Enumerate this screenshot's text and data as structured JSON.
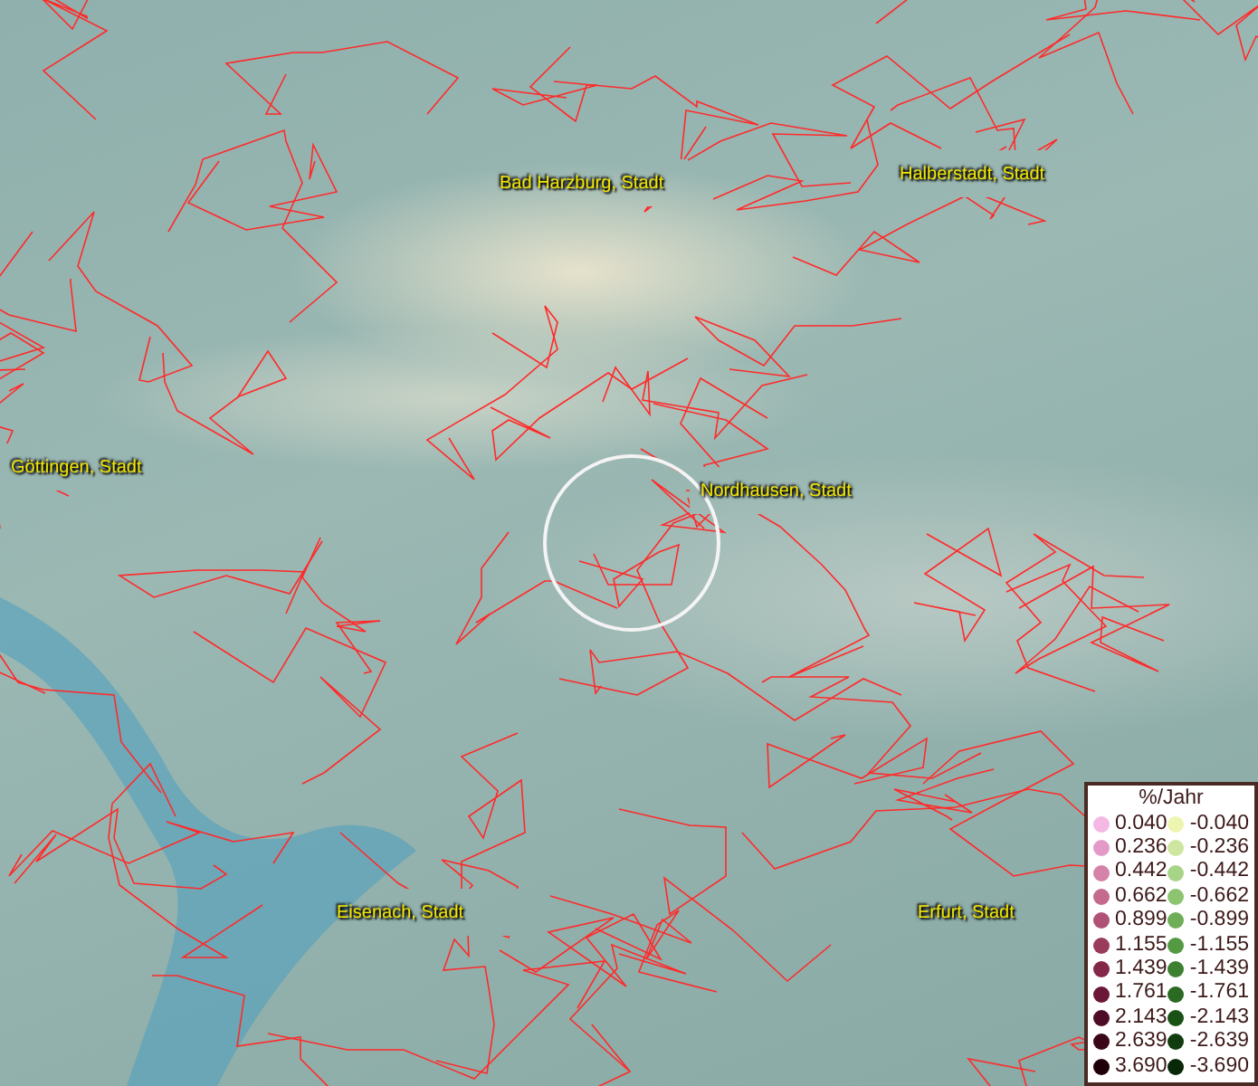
{
  "map": {
    "places": [
      {
        "name": "Bad Harzburg, Stadt"
      },
      {
        "name": "Halberstadt, Stadt"
      },
      {
        "name": "Göttingen, Stadt"
      },
      {
        "name": "Nordhausen, Stadt"
      },
      {
        "name": "Eisenach, Stadt"
      },
      {
        "name": "Erfurt, Stadt"
      }
    ]
  },
  "legend": {
    "title": "%/Jahr",
    "rows": [
      {
        "positive": {
          "value": "0.040",
          "color": "#f4b8e4"
        },
        "negative": {
          "value": "-0.040",
          "color": "#eef5b0"
        }
      },
      {
        "positive": {
          "value": "0.236",
          "color": "#e39ac8"
        },
        "negative": {
          "value": "-0.236",
          "color": "#cde6a0"
        }
      },
      {
        "positive": {
          "value": "0.442",
          "color": "#d482a8"
        },
        "negative": {
          "value": "-0.442",
          "color": "#a8d488"
        }
      },
      {
        "positive": {
          "value": "0.662",
          "color": "#c46a8c"
        },
        "negative": {
          "value": "-0.662",
          "color": "#8cc470"
        }
      },
      {
        "positive": {
          "value": "0.899",
          "color": "#b05275"
        },
        "negative": {
          "value": "-0.899",
          "color": "#6fae58"
        }
      },
      {
        "positive": {
          "value": "1.155",
          "color": "#9a3b5c"
        },
        "negative": {
          "value": "-1.155",
          "color": "#549a42"
        }
      },
      {
        "positive": {
          "value": "1.439",
          "color": "#832848"
        },
        "negative": {
          "value": "-1.439",
          "color": "#3d8030"
        }
      },
      {
        "positive": {
          "value": "1.761",
          "color": "#6b1838"
        },
        "negative": {
          "value": "-1.761",
          "color": "#2a6a22"
        }
      },
      {
        "positive": {
          "value": "2.143",
          "color": "#4f0c26"
        },
        "negative": {
          "value": "-2.143",
          "color": "#1a5216"
        }
      },
      {
        "positive": {
          "value": "2.639",
          "color": "#3a0618"
        },
        "negative": {
          "value": "-2.639",
          "color": "#103c0e"
        }
      },
      {
        "positive": {
          "value": "3.690",
          "color": "#200008"
        },
        "negative": {
          "value": "-3.690",
          "color": "#082808"
        }
      }
    ]
  }
}
